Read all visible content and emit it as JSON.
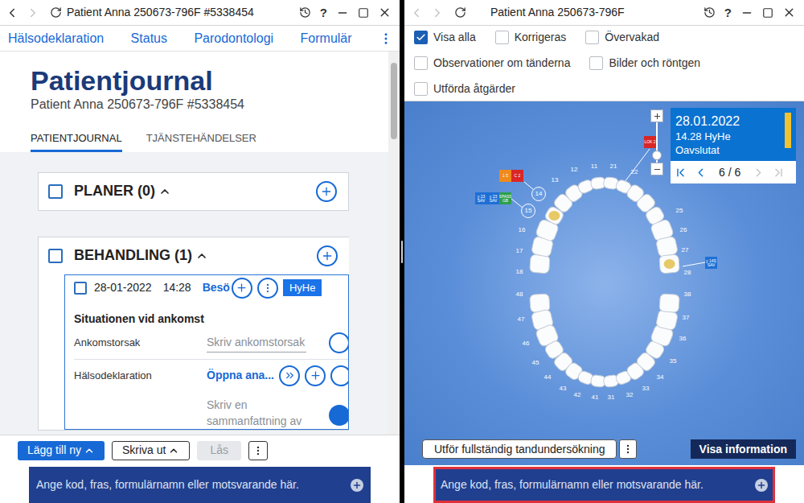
{
  "left_window": {
    "title": "Patient Anna 250673-796F #5338454",
    "help": "?",
    "back_disabled": false,
    "forward_disabled": true,
    "menu": [
      "Hälsodeklaration",
      "Status",
      "Parodontologi",
      "Formulär"
    ],
    "heading": "Patientjournal",
    "subtitle": "Patient Anna 250673-796F #5338454",
    "tabs": [
      {
        "label": "PATIENTJOURNAL",
        "selected": true
      },
      {
        "label": "TJÄNSTEHÄNDELSER",
        "selected": false
      }
    ],
    "sections": [
      {
        "title": "PLANER (0)",
        "checked": false,
        "expanded": true
      },
      {
        "title": "BEHANDLING (1)",
        "checked": false,
        "expanded": true
      }
    ],
    "visit": {
      "checked": false,
      "date": "28-01-2022",
      "time": "14:28",
      "type": "Besö",
      "badge": "HyHe",
      "badge_color": "#1a73e8",
      "marker_color": "#f28c1a",
      "heading": "Situationen vid ankomst",
      "fields": [
        {
          "label": "Ankomstorsak",
          "kind": "placeholder",
          "value": "Skriv ankomstorsak"
        },
        {
          "label": "Hälsodeklaration",
          "kind": "link",
          "value": "Öppna ana..."
        }
      ],
      "summary_placeholder": "Skriv en sammanfattning av"
    },
    "scrollbar": {
      "position": 0.03,
      "size": 0.2
    },
    "toolbar": [
      {
        "label": "Lägg till ny",
        "kind": "primary",
        "disabled": false,
        "dropdown": true
      },
      {
        "label": "Skriva ut",
        "kind": "outline",
        "disabled": false,
        "dropdown": true
      },
      {
        "label": "Lås",
        "kind": "outline",
        "disabled": true,
        "dropdown": false
      }
    ],
    "command": {
      "placeholder": "Ange kod, fras, formulärnamn eller motsvarande här.",
      "focused": false
    }
  },
  "right_window": {
    "title": "Patient Anna 250673-796F",
    "help": "?",
    "back_disabled": true,
    "forward_disabled": true,
    "filters": [
      {
        "label": "Visa alla",
        "checked": true
      },
      {
        "label": "Korrigeras",
        "checked": false
      },
      {
        "label": "Övervakad",
        "checked": false
      },
      {
        "label": "Observationer om tänderna",
        "checked": false
      },
      {
        "label": "Bilder och röntgen",
        "checked": false
      },
      {
        "label": "Utförda åtgärder",
        "checked": false
      }
    ],
    "teeth": [
      {
        "number": "18",
        "circled": false,
        "filling": false
      },
      {
        "number": "17",
        "circled": false,
        "filling": false
      },
      {
        "number": "16",
        "circled": false,
        "filling": false
      },
      {
        "number": "15",
        "circled": true,
        "filling": true
      },
      {
        "number": "14",
        "circled": true,
        "filling": false
      },
      {
        "number": "13",
        "circled": false,
        "filling": false
      },
      {
        "number": "12",
        "circled": false,
        "filling": false
      },
      {
        "number": "11",
        "circled": false,
        "filling": false
      },
      {
        "number": "21",
        "circled": false,
        "filling": false
      },
      {
        "number": "22",
        "circled": false,
        "filling": false
      },
      {
        "number": "25",
        "circled": false,
        "filling": false
      },
      {
        "number": "26",
        "circled": false,
        "filling": false
      },
      {
        "number": "27",
        "circled": false,
        "filling": false
      },
      {
        "number": "28",
        "circled": false,
        "filling": true
      },
      {
        "number": "48",
        "circled": false,
        "filling": false
      },
      {
        "number": "47",
        "circled": false,
        "filling": false
      },
      {
        "number": "46",
        "circled": false,
        "filling": false
      },
      {
        "number": "45",
        "circled": false,
        "filling": false
      },
      {
        "number": "44",
        "circled": false,
        "filling": false
      },
      {
        "number": "43",
        "circled": false,
        "filling": false
      },
      {
        "number": "42",
        "circled": false,
        "filling": false
      },
      {
        "number": "41",
        "circled": false,
        "filling": false
      },
      {
        "number": "31",
        "circled": false,
        "filling": false
      },
      {
        "number": "32",
        "circled": false,
        "filling": false
      },
      {
        "number": "33",
        "circled": false,
        "filling": false
      },
      {
        "number": "34",
        "circled": false,
        "filling": false
      },
      {
        "number": "35",
        "circled": false,
        "filling": false
      },
      {
        "number": "36",
        "circled": false,
        "filling": false
      },
      {
        "number": "37",
        "circled": false,
        "filling": false
      },
      {
        "number": "38",
        "circled": false,
        "filling": false
      }
    ],
    "tags": [
      {
        "label": "LOK 2",
        "color": "#d92626"
      },
      {
        "label": "1 5",
        "color": "#f08a1c"
      },
      {
        "label": "C 2",
        "color": "#d92626"
      },
      {
        "label": "y 23 SAV",
        "color": "#1f6fd6"
      },
      {
        "label": "y 23 SAV",
        "color": "#1f6fd6"
      },
      {
        "label": "SPASS GB",
        "color": "#2e9e4f"
      },
      {
        "label": "y 14S SAV",
        "color": "#1f6fd6"
      }
    ],
    "record": {
      "date": "28.01.2022",
      "detail": "14.28 HyHe",
      "status": "Oavslutat",
      "status_color": "#f2c230",
      "page": "6 / 6",
      "prev_disabled": false,
      "next_disabled": true
    },
    "zoom": {
      "level": 0.18
    },
    "actions": [
      {
        "label": "Utför fullständig tandundersökning",
        "kind": "outline"
      },
      {
        "label": "Visa information",
        "kind": "dark"
      }
    ],
    "command": {
      "placeholder": "Ange kod, fras, formulärnamn eller motsvarande här.",
      "focused": true
    }
  }
}
